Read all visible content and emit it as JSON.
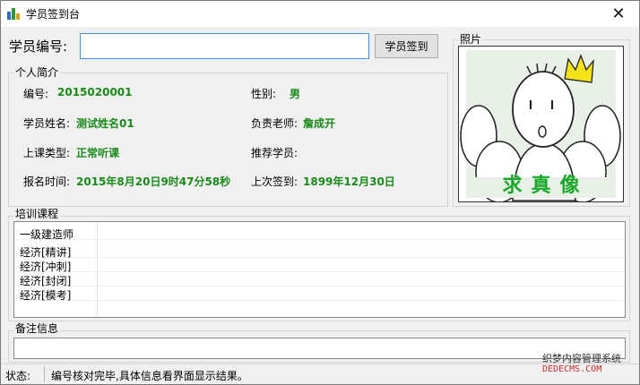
{
  "window": {
    "title": "学员签到台",
    "close_glyph": "✕"
  },
  "search": {
    "label": "学员编号:",
    "value": "",
    "placeholder": "",
    "button_label": "学员签到"
  },
  "photo": {
    "legend": "照片",
    "caption": "求真像"
  },
  "profile": {
    "legend": "个人简介",
    "id_label": "编号:",
    "id_value": "2015020001",
    "gender_label": "性别:",
    "gender_value": "男",
    "name_label": "学员姓名:",
    "name_value": "测试姓名01",
    "teacher_label": "负责老师:",
    "teacher_value": "詹成开",
    "class_type_label": "上课类型:",
    "class_type_value": "正常听课",
    "referrer_label": "推荐学员:",
    "referrer_value": "",
    "enroll_time_label": "报名时间:",
    "enroll_time_value": "2015年8月20日9时47分58秒",
    "last_signin_label": "上次签到:",
    "last_signin_value": "1899年12月30日"
  },
  "courses": {
    "legend": "培训课程",
    "items": [
      "一级建造师",
      "经济[精讲]",
      "经济[冲刺]",
      "经济[封闭]",
      "经济[模考]"
    ]
  },
  "remarks": {
    "legend": "备注信息",
    "value": ""
  },
  "status": {
    "label": "状态:",
    "text": "编号核对完毕,具体信息看界面显示结果。"
  },
  "watermark": {
    "line1": "织梦内容管理系统",
    "line2": "DEDECMS.COM"
  }
}
